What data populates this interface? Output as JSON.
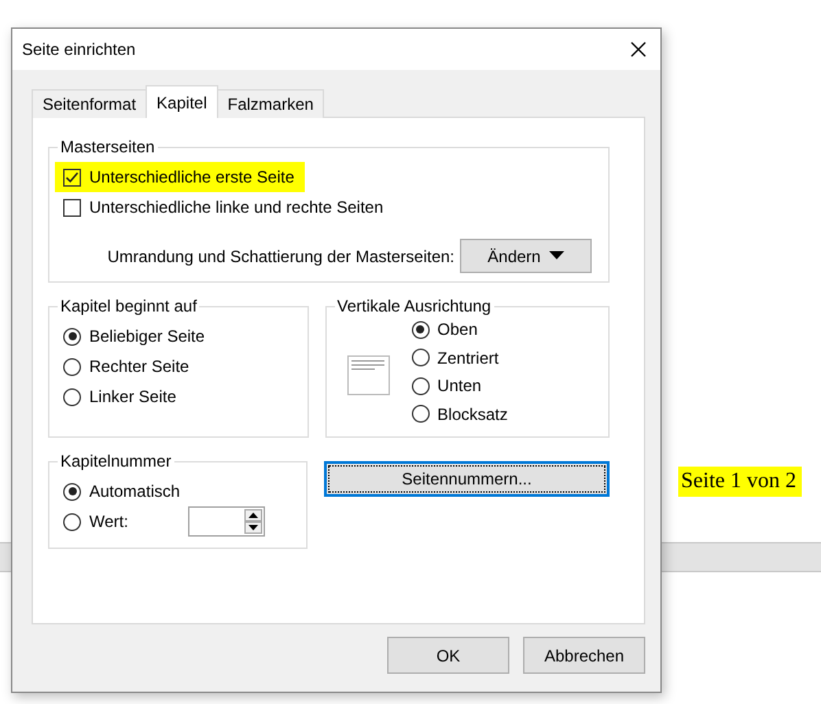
{
  "window": {
    "title": "Seite einrichten"
  },
  "tabs": [
    {
      "label": "Seitenformat",
      "selected": false
    },
    {
      "label": "Kapitel",
      "selected": true
    },
    {
      "label": "Falzmarken",
      "selected": false
    }
  ],
  "master_pages": {
    "title": "Masterseiten",
    "options": [
      {
        "label": "Unterschiedliche erste Seite",
        "checked": true,
        "highlighted": true
      },
      {
        "label": "Unterschiedliche linke und rechte Seiten",
        "checked": false,
        "highlighted": false
      }
    ],
    "border_label": "Umrandung und Schattierung der Masterseiten:",
    "change_button": "Ändern"
  },
  "chapter_start": {
    "title": "Kapitel beginnt auf",
    "options": [
      {
        "label": "Beliebiger Seite",
        "selected": true
      },
      {
        "label": "Rechter Seite",
        "selected": false
      },
      {
        "label": "Linker Seite",
        "selected": false
      }
    ]
  },
  "vertical_alignment": {
    "title": "Vertikale Ausrichtung",
    "options": [
      {
        "label": "Oben",
        "selected": true
      },
      {
        "label": "Zentriert",
        "selected": false
      },
      {
        "label": "Unten",
        "selected": false
      },
      {
        "label": "Blocksatz",
        "selected": false
      }
    ]
  },
  "chapter_number": {
    "title": "Kapitelnummer",
    "options": [
      {
        "label": "Automatisch",
        "selected": true
      },
      {
        "label": "Wert:",
        "selected": false
      }
    ]
  },
  "page_numbers_button": "Seitennummern...",
  "buttons": [
    "OK",
    "Abbrechen"
  ],
  "document": {
    "page_label": "Seite 1 von 2",
    "highlighted": true
  }
}
